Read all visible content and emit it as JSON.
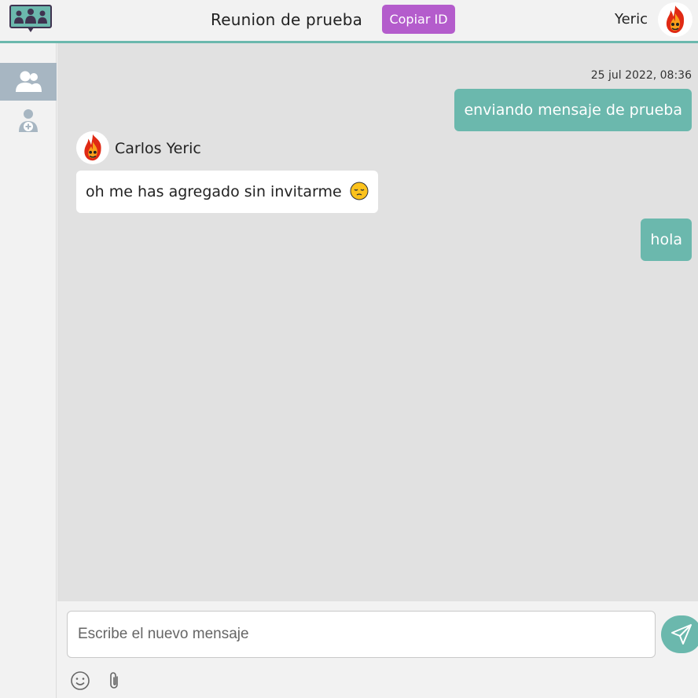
{
  "header": {
    "logo_icon": "meeting-group-icon",
    "room_title": "Reunion de prueba",
    "copy_id_label": "Copiar ID",
    "user_name": "Yeric",
    "user_avatar_icon": "fire-avatar-icon"
  },
  "sidebar": {
    "items": [
      {
        "icon": "participants-icon",
        "active": true
      },
      {
        "icon": "add-user-icon",
        "active": false
      }
    ]
  },
  "chat": {
    "timestamp": "25 jul 2022, 08:36",
    "messages": [
      {
        "direction": "out",
        "text": "enviando mensaje de prueba"
      },
      {
        "direction": "in",
        "sender": "Carlos Yeric",
        "text": "oh me has agregado sin invitarme",
        "emoji": "pensive-face-icon"
      },
      {
        "direction": "out",
        "text": "hola"
      }
    ]
  },
  "composer": {
    "placeholder": "Escribe el nuevo mensaje",
    "value": "",
    "send_icon": "paper-plane-icon",
    "tools": [
      "emoji-icon",
      "attach-icon"
    ]
  },
  "colors": {
    "accent": "#6bb8ad",
    "copy_button": "#b45ccc",
    "sidebar_active": "#a7b6c2",
    "chat_background": "#e1e1e1",
    "logo_dark": "#3f3350"
  }
}
